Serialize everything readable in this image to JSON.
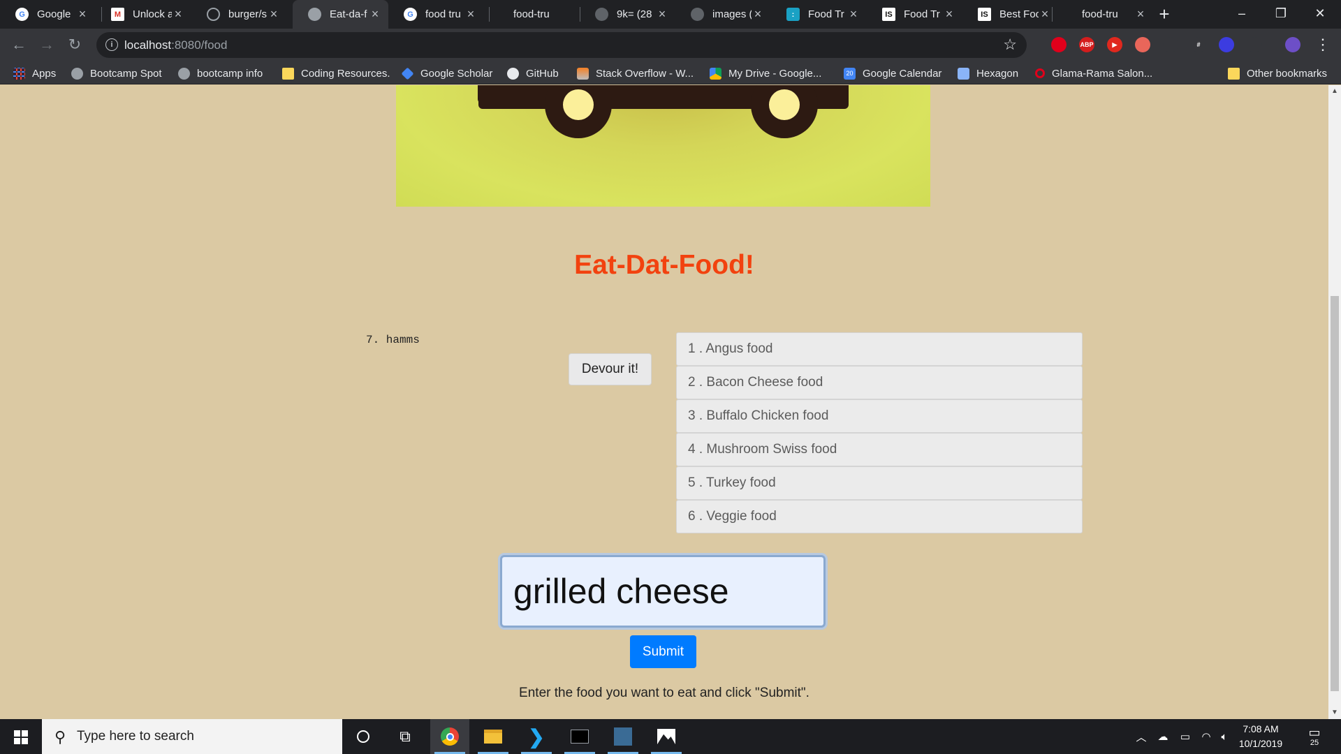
{
  "browser": {
    "tabs": [
      {
        "title": "Google",
        "icon": "google-icon",
        "color": "#4285f4"
      },
      {
        "title": "Unlock a",
        "icon": "gmail-icon",
        "color": "#d93025"
      },
      {
        "title": "burger/s",
        "icon": "github-icon",
        "color": "#24292e"
      },
      {
        "title": "Eat-da-f",
        "icon": "globe-icon",
        "color": "#9aa0a6"
      },
      {
        "title": "food tru",
        "icon": "google-icon",
        "color": "#4285f4"
      },
      {
        "title": "food-tru",
        "icon": "blank-icon",
        "color": "#35363a"
      },
      {
        "title": "9k= (28",
        "icon": "globe-icon",
        "color": "#9aa0a6"
      },
      {
        "title": "images (",
        "icon": "globe-icon",
        "color": "#9aa0a6"
      },
      {
        "title": "Food Tr",
        "icon": "food-truck-site-icon",
        "color": "#1aa1c4"
      },
      {
        "title": "Food Tr",
        "icon": "is-icon",
        "color": "#111111"
      },
      {
        "title": "Best Foo",
        "icon": "is-icon",
        "color": "#111111"
      },
      {
        "title": "food-tru",
        "icon": "blank-icon",
        "color": "#35363a"
      }
    ],
    "url_host": "localhost",
    "url_path": ":8080/food",
    "bookmarks": [
      {
        "label": "Apps",
        "icon": "apps-icon"
      },
      {
        "label": "Bootcamp Spot",
        "icon": "globe-icon"
      },
      {
        "label": "bootcamp info",
        "icon": "globe-icon"
      },
      {
        "label": "Coding Resources.",
        "icon": "folder-icon"
      },
      {
        "label": "Google Scholar",
        "icon": "scholar-icon"
      },
      {
        "label": "GitHub",
        "icon": "github-icon"
      },
      {
        "label": "Stack Overflow - W...",
        "icon": "stackoverflow-icon"
      },
      {
        "label": "My Drive - Google...",
        "icon": "drive-icon"
      },
      {
        "label": "Google Calendar",
        "icon": "calendar-icon"
      },
      {
        "label": "Hexagon",
        "icon": "hexagon-icon"
      },
      {
        "label": "Glama-Rama Salon...",
        "icon": "opera-icon"
      },
      {
        "label": "Other bookmarks",
        "icon": "folder-icon"
      }
    ],
    "extensions": [
      {
        "icon": "opera-icon",
        "color": "#e0001b",
        "text": ""
      },
      {
        "icon": "adblock-icon",
        "color": "#d41d1d",
        "text": "ABP"
      },
      {
        "icon": "video-icon",
        "color": "#e0281e",
        "text": "▶"
      },
      {
        "icon": "puzzle-icon",
        "color": "#e9665a",
        "text": ""
      },
      {
        "icon": "eyedropper-icon",
        "color": "#35363a",
        "text": ""
      },
      {
        "icon": "crop-icon",
        "color": "#35363a",
        "text": "#"
      },
      {
        "icon": "diamond-icon",
        "color": "#3c3ce0",
        "text": ""
      },
      {
        "icon": "code-icon",
        "color": "#35363a",
        "text": ""
      },
      {
        "icon": "profile-icon",
        "color": "#6d4fc7",
        "text": ""
      }
    ]
  },
  "page": {
    "heading": "Eat-Dat-Food!",
    "eaten_item": "7. hamms",
    "devour_label": "Devour it!",
    "menu": [
      "1 . Angus food",
      "2 . Bacon Cheese food",
      "3 . Buffalo Chicken food",
      "4 . Mushroom Swiss food",
      "5 . Turkey food",
      "6 . Veggie food"
    ],
    "input_value": "grilled cheese",
    "submit_label": "Submit",
    "hint": "Enter the food you want to eat and click \"Submit\".",
    "brand_color": "#f2420f",
    "button_color": "#007bff"
  },
  "taskbar": {
    "search_placeholder": "Type here to search",
    "time": "7:08 AM",
    "date": "10/1/2019",
    "notifications": "25"
  }
}
